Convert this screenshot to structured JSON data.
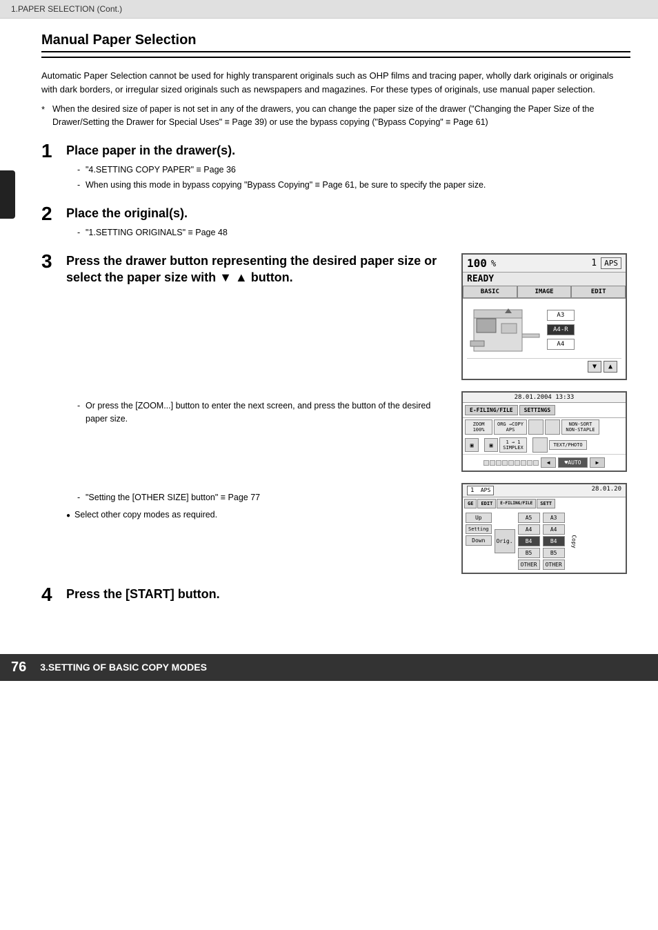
{
  "header": {
    "text": "1.PAPER SELECTION (Cont.)"
  },
  "section": {
    "title": "Manual Paper Selection"
  },
  "intro": {
    "text": "Automatic Paper Selection cannot be used for highly transparent originals such as OHP films and tracing paper, wholly dark originals or originals with dark borders, or irregular sized originals such as newspapers and magazines. For these types of originals, use manual paper selection."
  },
  "note": {
    "asterisk": "*",
    "text": "When the desired size of paper is not set in any of the drawers, you can change the paper size of the drawer (\"Changing the Paper Size of the Drawer/Setting the Drawer for Special Uses\" ≡ Page 39) or use the bypass copying (\"Bypass Copying\" ≡ Page 61)"
  },
  "steps": [
    {
      "number": "1",
      "title": "Place paper in the drawer(s).",
      "subs": [
        "\"4.SETTING COPY PAPER\" ≡ Page 36",
        "When using this mode in bypass copying \"Bypass Copying\" ≡ Page 61, be sure to specify the paper size."
      ]
    },
    {
      "number": "2",
      "title": "Place the original(s).",
      "subs": [
        "\"1.SETTING ORIGINALS\" ≡ Page 48"
      ]
    },
    {
      "number": "3",
      "title": "Press the drawer button representing the desired paper size or select the paper size with ▼ ▲ button.",
      "subs": []
    },
    {
      "number": "4",
      "title": "Press the [START] button.",
      "subs": []
    }
  ],
  "screen1": {
    "percent": "100",
    "pct_symbol": "%",
    "copy_num": "1",
    "aps_label": "APS",
    "ready_text": "READY",
    "tabs": [
      "BASIC",
      "IMAGE",
      "EDIT"
    ],
    "paper_sizes": [
      "A3",
      "A4-R",
      "A4"
    ],
    "selected_size": "A4-R",
    "nav_buttons": [
      "▼",
      "▲"
    ]
  },
  "screen2": {
    "datetime": "28.01.2004 13:33",
    "tabs": [
      "E-FILING/FILE",
      "SETTINGS"
    ],
    "row1": [
      "ZOOM\n100%",
      "ORG →COPY\nAPS",
      "",
      "NON-SORT\nNON-STAPLE"
    ],
    "row2": [
      "",
      "1 → 1\nSIMPLEX",
      "",
      "TEXT/PHOTO"
    ],
    "bottom_label": "♥AUTO"
  },
  "screen3": {
    "num": "1",
    "aps": "APS",
    "datetime": "28.01.20",
    "tabs": [
      "GE",
      "EDIT",
      "E-FILING/FILE",
      "SETT"
    ],
    "left_btns": [
      "p",
      "el\netting",
      "wn"
    ],
    "sizes_col1": [
      "A5",
      "A4",
      "B4",
      "B5",
      "OTHER"
    ],
    "sizes_col2": [
      "A3",
      "A4",
      "B4",
      "B5",
      "OTHER"
    ],
    "selected": "B4"
  },
  "or_note": {
    "text": "Or press the [ZOOM...] button to enter the next screen, and press the button of the desired paper size."
  },
  "setting_note": {
    "text": "\"Setting the [OTHER SIZE] button\" ≡ Page 77"
  },
  "select_note": {
    "text": "Select other copy modes as required."
  },
  "footer": {
    "page_number": "76",
    "text": "3.SETTING OF BASIC COPY MODES"
  }
}
